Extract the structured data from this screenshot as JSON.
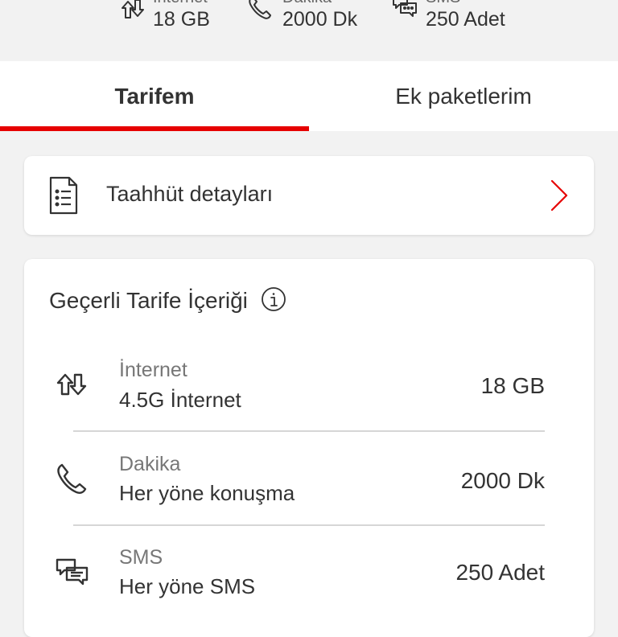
{
  "summary": {
    "internet": {
      "label": "İnternet",
      "value": "18 GB",
      "icon": "data-arrows-icon"
    },
    "dakika": {
      "label": "Dakika",
      "value": "2000 Dk",
      "icon": "phone-icon"
    },
    "sms": {
      "label": "SMS",
      "value": "250 Adet",
      "icon": "sms-bubbles-icon"
    }
  },
  "tabs": [
    {
      "label": "Tarifem",
      "active": true
    },
    {
      "label": "Ek paketlerim",
      "active": false
    }
  ],
  "commitment_card": {
    "title": "Taahhüt detayları",
    "icon": "document-icon",
    "chevron": "chevron-right-icon"
  },
  "tariff": {
    "heading": "Geçerli Tarife İçeriği",
    "info_icon": "info-icon",
    "rows": [
      {
        "label": "İnternet",
        "subtitle": "4.5G İnternet",
        "value": "18 GB",
        "icon": "data-arrows-icon"
      },
      {
        "label": "Dakika",
        "subtitle": "Her yöne konuşma",
        "value": "2000 Dk",
        "icon": "phone-icon"
      },
      {
        "label": "SMS",
        "subtitle": "Her yöne SMS",
        "value": "250 Adet",
        "icon": "sms-bubbles-icon"
      }
    ]
  },
  "colors": {
    "accent": "#e60000",
    "background": "#f2f2f2",
    "card": "#ffffff",
    "text": "#333333",
    "muted": "#777777"
  }
}
